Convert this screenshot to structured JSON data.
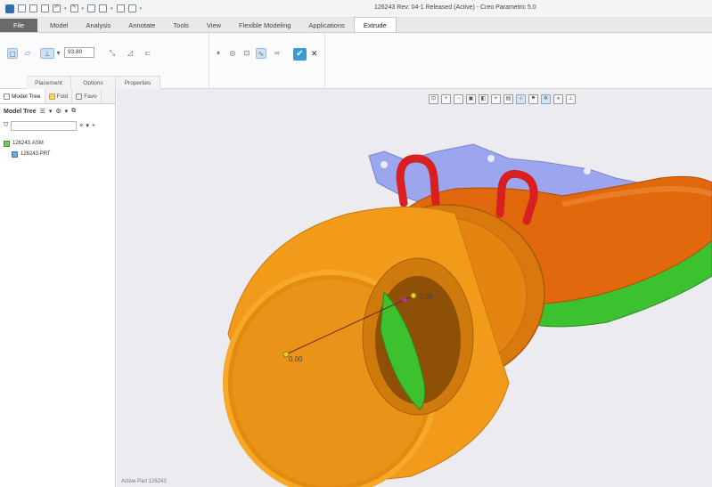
{
  "window": {
    "title": "126243 Rev: 04-1 Released (Active) - Creo Parametric 5.0"
  },
  "tabs": [
    {
      "label": "File"
    },
    {
      "label": "Model"
    },
    {
      "label": "Analysis"
    },
    {
      "label": "Annotate"
    },
    {
      "label": "Tools"
    },
    {
      "label": "View"
    },
    {
      "label": "Flexible Modeling"
    },
    {
      "label": "Applications"
    },
    {
      "label": "Extrude",
      "active": true
    }
  ],
  "ribbon": {
    "depth_value": "93.80",
    "subtabs": [
      "Placement",
      "Options",
      "Properties"
    ]
  },
  "left_panel": {
    "tabs": [
      "Model Tree",
      "Fold",
      "Favo"
    ],
    "header_title": "Model Tree",
    "search_placeholder": "",
    "tree": [
      {
        "label": "126243.ASM",
        "type": "assembly"
      },
      {
        "label": "126243.PRT",
        "type": "part"
      }
    ]
  },
  "graphics": {
    "dim_outer": "0.00",
    "dim_inner": "0.09",
    "status_text": "Active Part 126243"
  },
  "colors": {
    "tube": "#f29b1a",
    "tube_inner": "#e08a10",
    "body": "#e2680e",
    "flange": "#9aa6f0",
    "handles": "#d82020",
    "green": "#3cc22e",
    "accent": "#3a9ad9"
  }
}
